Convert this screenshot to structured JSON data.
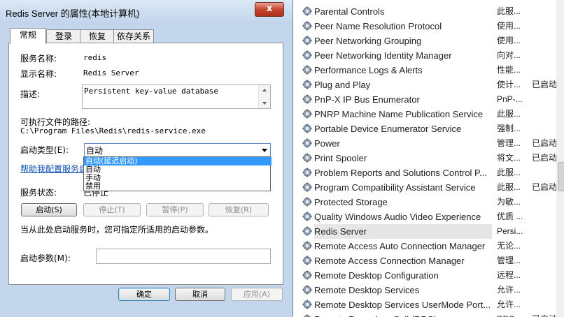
{
  "services": {
    "rows": [
      {
        "name": "Parental Controls",
        "desc": "此服...",
        "status": ""
      },
      {
        "name": "Peer Name Resolution Protocol",
        "desc": "使用...",
        "status": ""
      },
      {
        "name": "Peer Networking Grouping",
        "desc": "使用...",
        "status": ""
      },
      {
        "name": "Peer Networking Identity Manager",
        "desc": "向对...",
        "status": ""
      },
      {
        "name": "Performance Logs & Alerts",
        "desc": "性能...",
        "status": ""
      },
      {
        "name": "Plug and Play",
        "desc": "使计...",
        "status": "已启动"
      },
      {
        "name": "PnP-X IP Bus Enumerator",
        "desc": "PnP-...",
        "status": ""
      },
      {
        "name": "PNRP Machine Name Publication Service",
        "desc": "此服...",
        "status": ""
      },
      {
        "name": "Portable Device Enumerator Service",
        "desc": "强制...",
        "status": ""
      },
      {
        "name": "Power",
        "desc": "管理...",
        "status": "已启动"
      },
      {
        "name": "Print Spooler",
        "desc": "将文...",
        "status": "已启动"
      },
      {
        "name": "Problem Reports and Solutions Control P...",
        "desc": "此服...",
        "status": ""
      },
      {
        "name": "Program Compatibility Assistant Service",
        "desc": "此服...",
        "status": "已启动"
      },
      {
        "name": "Protected Storage",
        "desc": "为敏...",
        "status": ""
      },
      {
        "name": "Quality Windows Audio Video Experience",
        "desc": "优质 ...",
        "status": ""
      },
      {
        "name": "Redis Server",
        "desc": "Persi...",
        "status": ""
      },
      {
        "name": "Remote Access Auto Connection Manager",
        "desc": "无论...",
        "status": ""
      },
      {
        "name": "Remote Access Connection Manager",
        "desc": "管理...",
        "status": ""
      },
      {
        "name": "Remote Desktop Configuration",
        "desc": "远程...",
        "status": ""
      },
      {
        "name": "Remote Desktop Services",
        "desc": "允许...",
        "status": ""
      },
      {
        "name": "Remote Desktop Services UserMode Port...",
        "desc": "允许...",
        "status": ""
      },
      {
        "name": "Remote Procedure Call (RPC)",
        "desc": "RPC...",
        "status": "已启动"
      }
    ],
    "selected_index": 15,
    "icon": "gear-icon"
  },
  "dialog": {
    "title": "Redis Server 的属性(本地计算机)",
    "close_label": "x",
    "tabs": [
      "常规",
      "登录",
      "恢复",
      "依存关系"
    ],
    "service_name_label": "服务名称:",
    "service_name_value": "redis",
    "display_name_label": "显示名称:",
    "display_name_value": "Redis Server",
    "description_label": "描述:",
    "description_value": "Persistent key-value database",
    "exec_path_label": "可执行文件的路径:",
    "exec_path_value": "C:\\Program Files\\Redis\\redis-service.exe",
    "startup_type_label": "启动类型(E):",
    "startup_type_value": "自动",
    "startup_options": [
      "自动(延迟启动)",
      "自动",
      "手动",
      "禁用"
    ],
    "help_link": "帮助我配置服务启动选项。",
    "status_label": "服务状态:",
    "status_value": "已停止",
    "btn_start": "启动(S)",
    "btn_stop": "停止(T)",
    "btn_pause": "暂停(P)",
    "btn_resume": "恢复(R)",
    "hint": "当从此处启动服务时，您可指定所适用的启动参数。",
    "params_label": "启动参数(M):",
    "params_value": "",
    "btn_ok": "确定",
    "btn_cancel": "取消",
    "btn_apply": "应用(A)"
  }
}
